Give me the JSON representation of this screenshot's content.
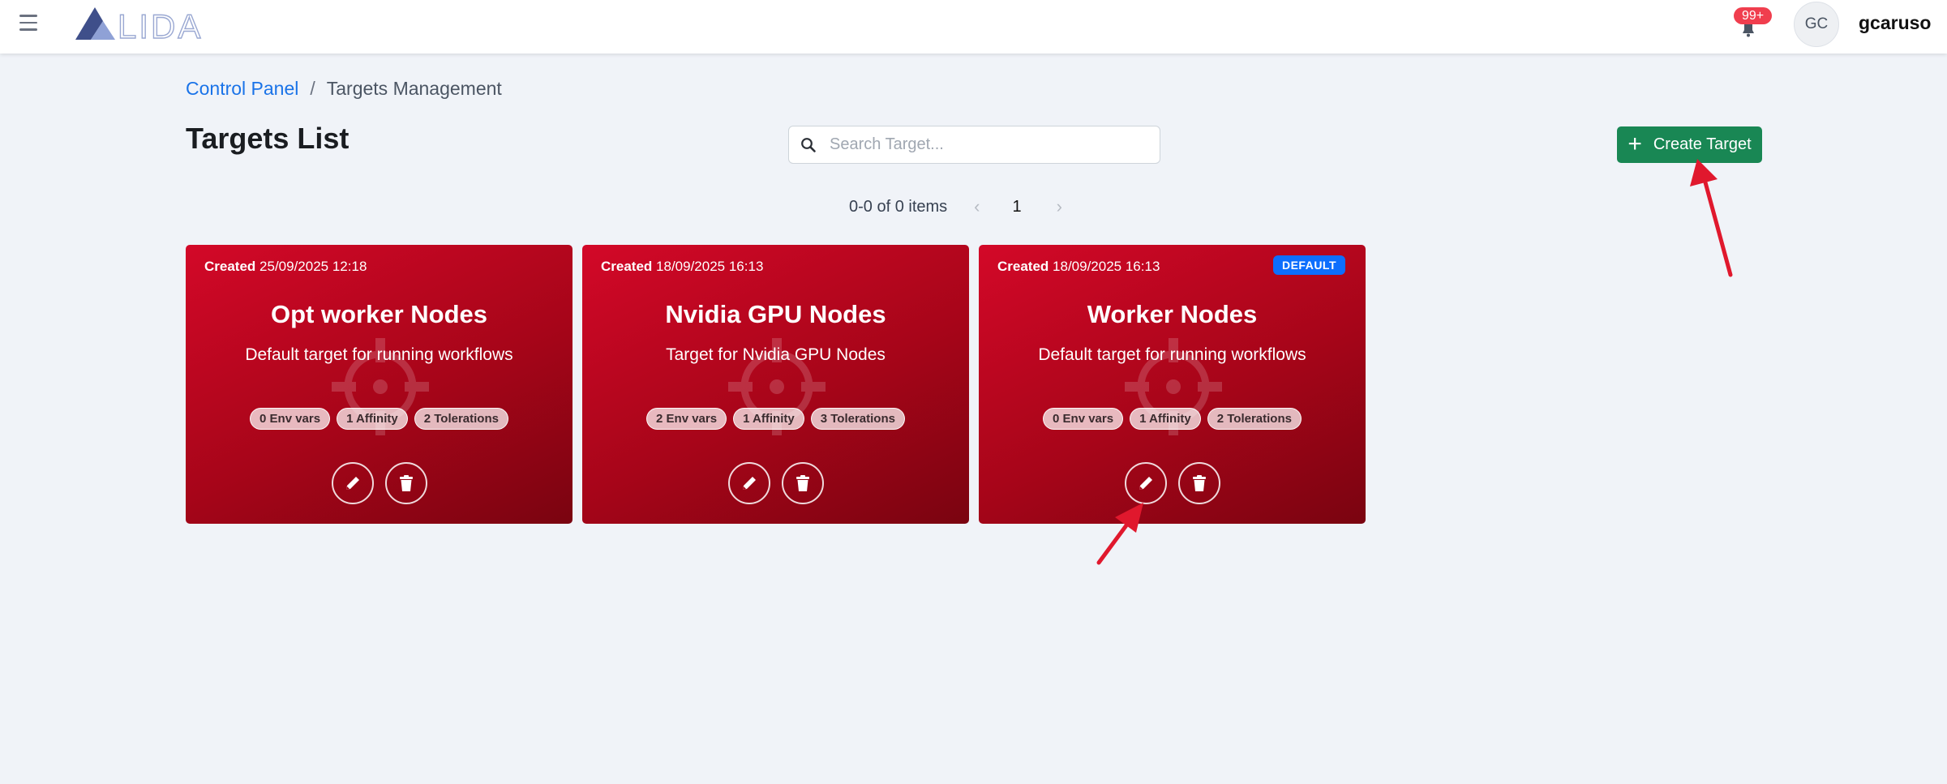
{
  "header": {
    "logo_text": "ALIDA",
    "notifications_badge": "99+",
    "avatar_initials": "GC",
    "username": "gcaruso"
  },
  "breadcrumb": {
    "parent": "Control Panel",
    "separator": "/",
    "current": "Targets Management"
  },
  "page": {
    "title": "Targets List"
  },
  "search": {
    "placeholder": "Search Target..."
  },
  "toolbar": {
    "create_label": "Create Target"
  },
  "pagination": {
    "summary": "0-0 of 0 items",
    "current_page": "1"
  },
  "cards": [
    {
      "created_label": "Created",
      "created_date": "25/09/2025 12:18",
      "title": "Opt worker Nodes",
      "description": "Default target for running workflows",
      "chips": [
        "0 Env vars",
        "1 Affinity",
        "2 Tolerations"
      ],
      "is_default": false
    },
    {
      "created_label": "Created",
      "created_date": "18/09/2025 16:13",
      "title": "Nvidia GPU Nodes",
      "description": "Target for Nvidia GPU Nodes",
      "chips": [
        "2 Env vars",
        "1 Affinity",
        "3 Tolerations"
      ],
      "is_default": false
    },
    {
      "created_label": "Created",
      "created_date": "18/09/2025 16:13",
      "title": "Worker Nodes",
      "description": "Default target for running workflows",
      "chips": [
        "0 Env vars",
        "1 Affinity",
        "2 Tolerations"
      ],
      "is_default": true,
      "default_label": "DEFAULT"
    }
  ],
  "icons": {
    "menu": "hamburger-icon",
    "notifications": "bell-icon",
    "search": "search-icon",
    "create": "plus-icon",
    "edit": "pencil-icon",
    "delete": "trash-icon",
    "card_watermark": "crosshair-icon",
    "annotation": "red-arrow"
  },
  "colors": {
    "primary_link": "#1a73e8",
    "create_button": "#198754",
    "card_red": "#c70522",
    "default_badge": "#0d6efd",
    "notification_badge": "#f03e4e",
    "annotation_arrow": "#e0182d"
  }
}
